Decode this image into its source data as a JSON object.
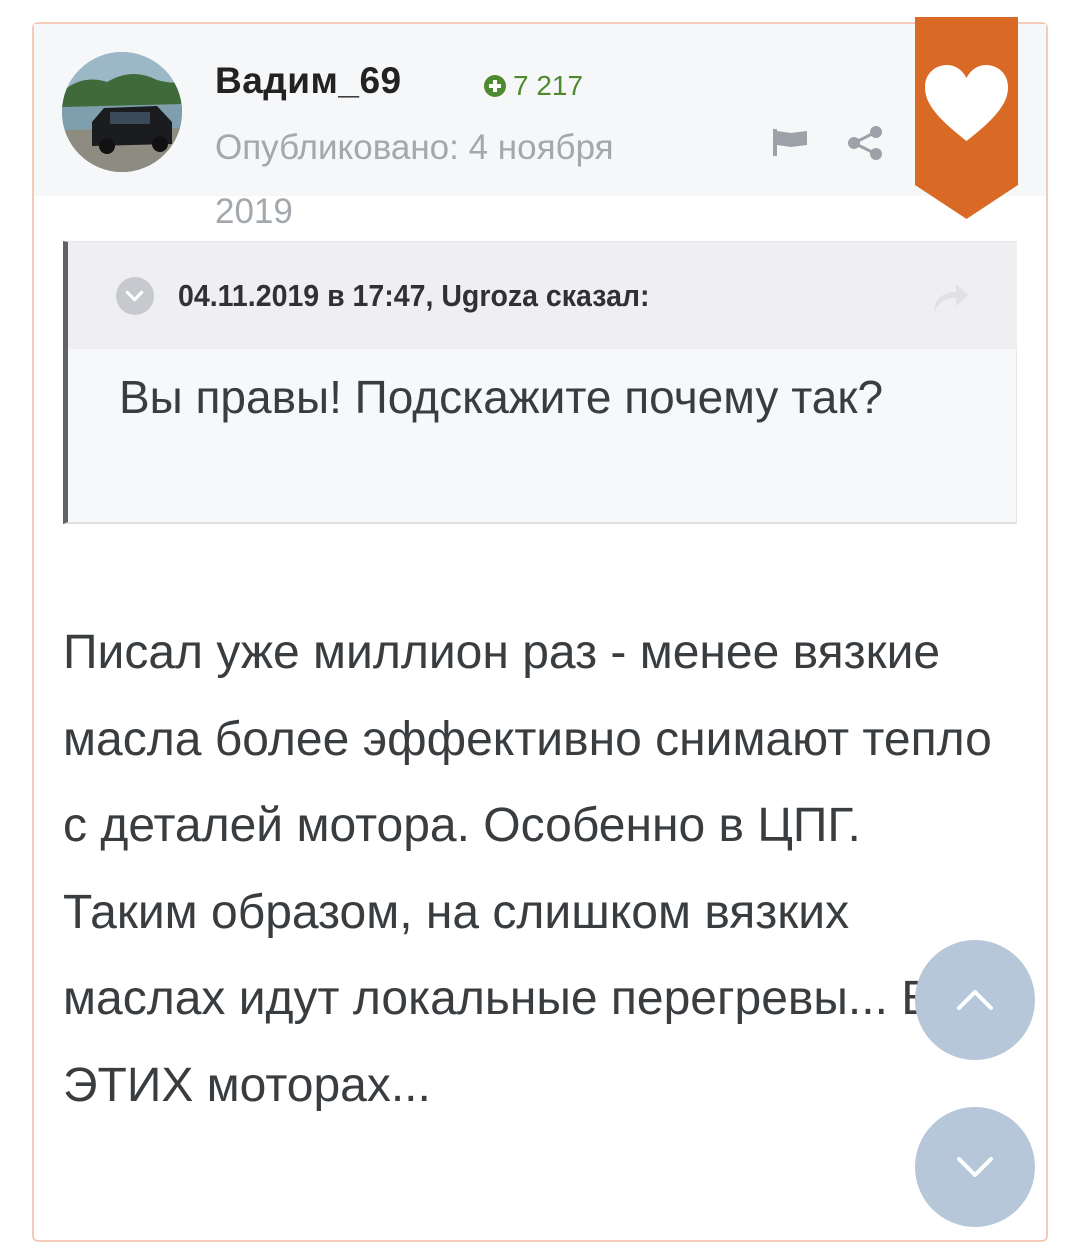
{
  "post": {
    "author": {
      "name": "Вадим_69",
      "reputation": "7 217",
      "published": "Опубликовано: 4 ноября 2019"
    },
    "quote": {
      "citation": "04.11.2019 в 17:47, Ugroza сказал:",
      "text": "Вы правы! Подскажите почему так?"
    },
    "text": "Писал уже миллион раз - менее вязкие масла более эффективно снимают тепло с деталей мотора. Особенно в ЦПГ. Таким образом, на слишком вязких маслах идут локальные перегревы... В ЭТИХ моторах..."
  },
  "icons": {
    "reputation": "plus-circle-icon",
    "report": "flag-icon",
    "share": "share-icon",
    "like": "heart-icon",
    "quote_toggle": "chevron-down-icon",
    "quote_goto": "reply-arrow-icon",
    "scroll_up": "chevron-up-icon",
    "scroll_down": "chevron-down-icon"
  },
  "colors": {
    "accent": "#d96a25",
    "reputation_green": "#4e8a2f",
    "scroll_button": "#b6c7d9"
  }
}
